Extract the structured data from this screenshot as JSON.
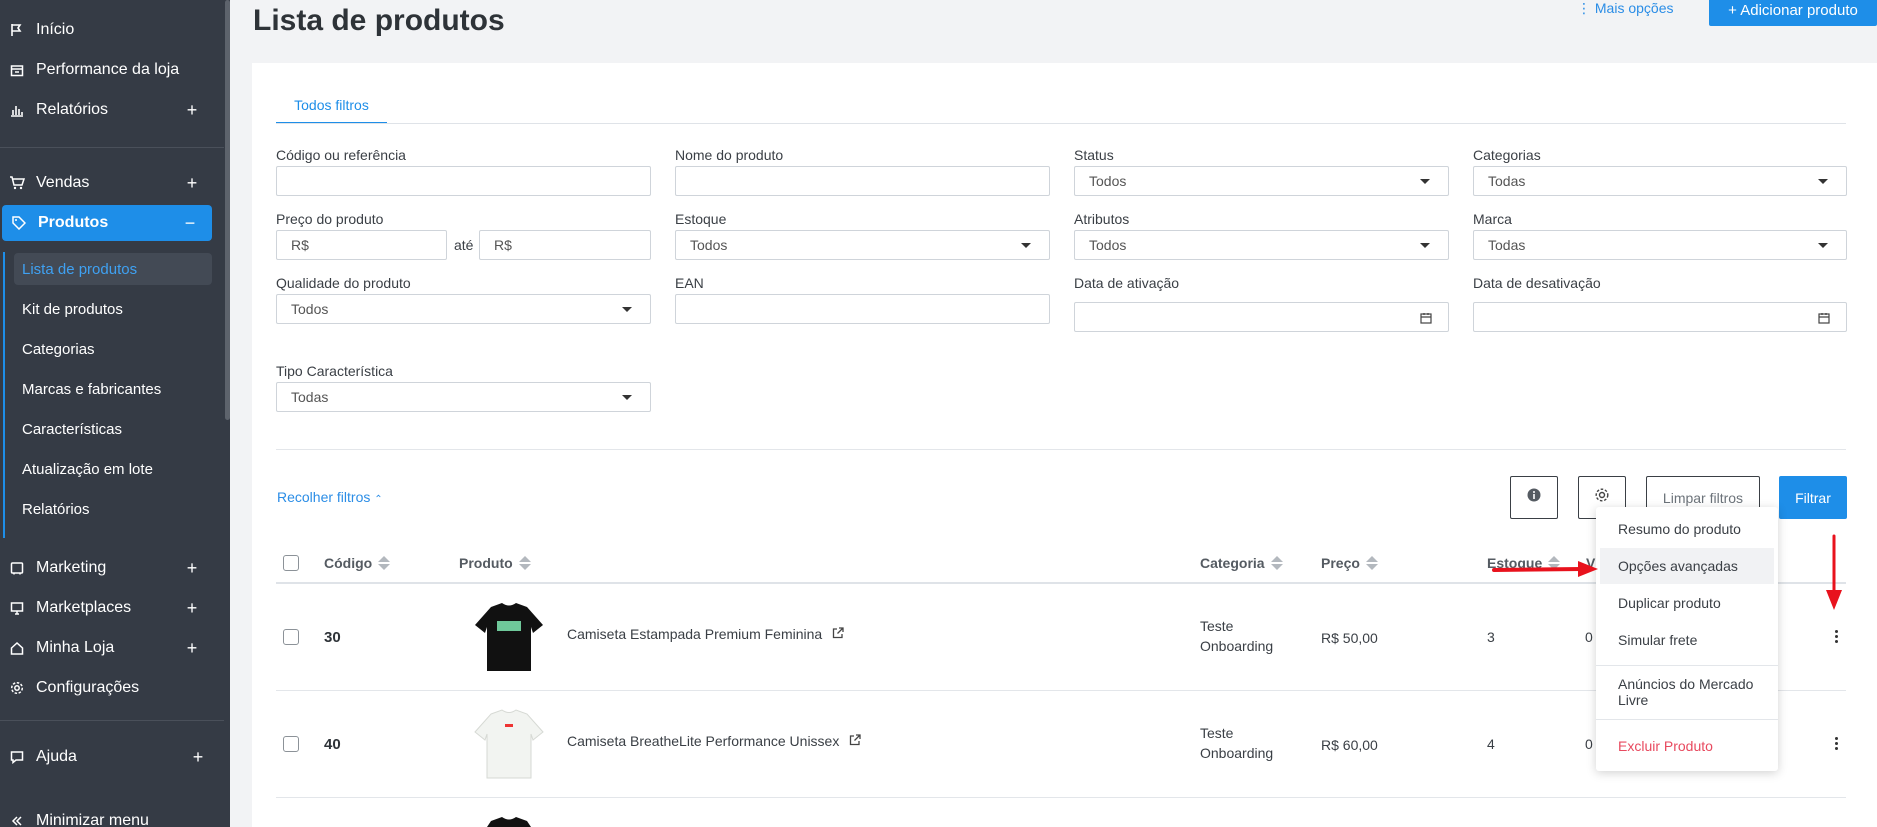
{
  "sidebar": {
    "items": [
      {
        "label": "Início",
        "icon": "flag-icon"
      },
      {
        "label": "Performance da loja",
        "icon": "store-icon"
      },
      {
        "label": "Relatórios",
        "icon": "bar-chart-icon",
        "expand": "+"
      },
      {
        "label": "Vendas",
        "icon": "cart-icon",
        "expand": "+"
      },
      {
        "label": "Produtos",
        "icon": "tag-icon",
        "expand": "−"
      },
      {
        "label": "Marketing",
        "icon": "megaphone-icon",
        "expand": "+"
      },
      {
        "label": "Marketplaces",
        "icon": "monitor-icon",
        "expand": "+"
      },
      {
        "label": "Minha Loja",
        "icon": "house-icon",
        "expand": "+"
      },
      {
        "label": "Configurações",
        "icon": "gear-icon"
      },
      {
        "label": "Ajuda",
        "icon": "chat-icon",
        "expand": "+"
      },
      {
        "label": "Minimizar menu",
        "icon": "double-chevron-left-icon"
      }
    ],
    "subitems": [
      "Lista de produtos",
      "Kit de produtos",
      "Categorias",
      "Marcas e fabricantes",
      "Características",
      "Atualização em lote",
      "Relatórios"
    ],
    "accent": "#1e8ee8"
  },
  "header": {
    "title": "Lista de produtos",
    "more_options": "Mais opções",
    "add_product": "+ Adicionar produto"
  },
  "filters": {
    "tab": "Todos filtros",
    "code_label": "Código ou referência",
    "code_value": "",
    "name_label": "Nome do produto",
    "name_value": "",
    "status_label": "Status",
    "status_value": "Todos",
    "categories_label": "Categorias",
    "categories_value": "Todas",
    "price_label": "Preço do produto",
    "price_from": "R$",
    "price_between": "até",
    "price_to": "R$",
    "stock_label": "Estoque",
    "stock_value": "Todos",
    "attributes_label": "Atributos",
    "attributes_value": "Todos",
    "brand_label": "Marca",
    "brand_value": "Todas",
    "quality_label": "Qualidade do produto",
    "quality_value": "Todos",
    "ean_label": "EAN",
    "ean_value": "",
    "activation_label": "Data de ativação",
    "deactivation_label": "Data de desativação",
    "feature_type_label": "Tipo Característica",
    "feature_type_value": "Todas",
    "collapse": "Recolher filtros",
    "clear": "Limpar filtros",
    "filter": "Filtrar"
  },
  "table": {
    "headers": {
      "code": "Código",
      "product": "Produto",
      "category": "Categoria",
      "price": "Preço",
      "stock": "Estoque",
      "v": "V"
    },
    "rows": [
      {
        "code": "30",
        "name": "Camiseta Estampada Premium Feminina",
        "category_line1": "Teste",
        "category_line2": "Onboarding",
        "price": "R$ 50,00",
        "stock": "3",
        "v": "0",
        "thumb_color": "#111"
      },
      {
        "code": "40",
        "name": "Camiseta BreatheLite Performance Unissex",
        "category_line1": "Teste",
        "category_line2": "Onboarding",
        "price": "R$ 60,00",
        "stock": "4",
        "v": "0",
        "thumb_color": "#f2f4f1"
      }
    ]
  },
  "menu": {
    "items": [
      "Resumo do produto",
      "Opções avançadas",
      "Duplicar produto",
      "Simular frete",
      "Anúncios do Mercado Livre",
      "Excluir Produto"
    ],
    "danger_color": "#e84a5f"
  },
  "annotation_color": "#e8121d"
}
